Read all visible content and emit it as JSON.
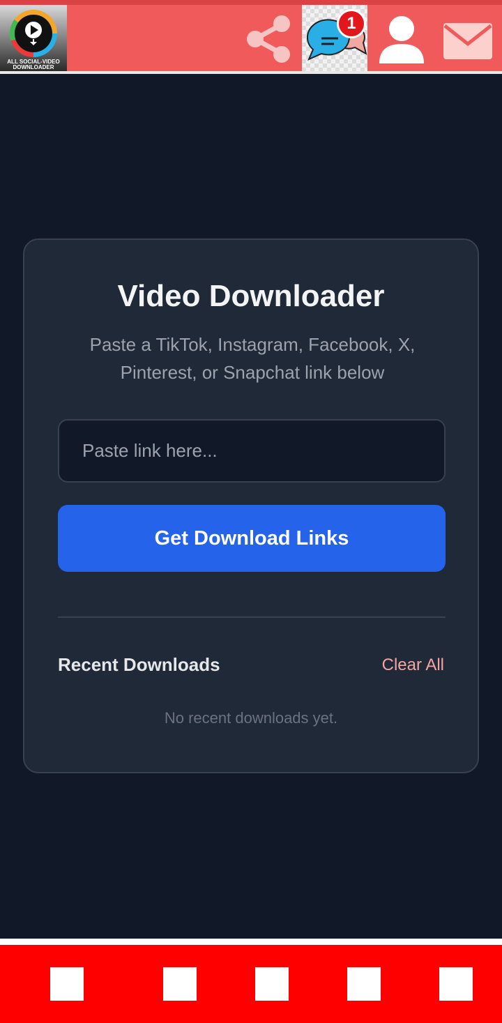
{
  "header": {
    "logo_caption": "All Social-Video Downloader",
    "icons": {
      "share": "share-icon",
      "chat": "chat-bubbles-icon",
      "user": "user-icon",
      "mail": "mail-icon"
    },
    "chat_badge_count": "1"
  },
  "card": {
    "title": "Video Downloader",
    "subtitle": "Paste a TikTok, Instagram, Facebook, X, Pinterest, or Snapchat link below",
    "input_placeholder": "Paste link here...",
    "input_value": "",
    "button_label": "Get Download Links",
    "recent_title": "Recent Downloads",
    "clear_all_label": "Clear All",
    "empty_message": "No recent downloads yet."
  },
  "bottom_nav": {
    "tiles": [
      "tile-1",
      "tile-2",
      "tile-3",
      "tile-4",
      "tile-5"
    ]
  },
  "colors": {
    "top_bar": "#f05a5a",
    "page_bg": "#111827",
    "card_bg": "#1f2937",
    "accent_button": "#2563eb",
    "clear_all": "#f5a3a3",
    "bottom_bar": "#ff0000",
    "badge": "#e3171b"
  }
}
